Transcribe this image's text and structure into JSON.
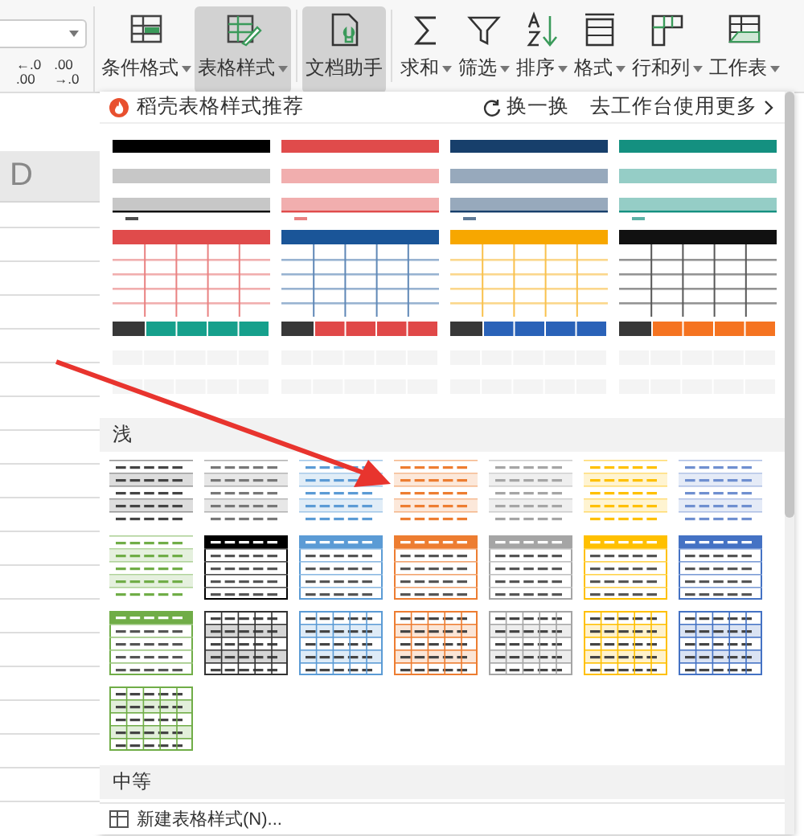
{
  "ribbon": {
    "decimal_buttons": [
      {
        "top": "←.0",
        "bottom": ".00"
      },
      {
        "top": ".00",
        "bottom": "→.0"
      }
    ],
    "tools": [
      {
        "label": "条件格式",
        "dropdown": true,
        "highlighted": false
      },
      {
        "label": "表格样式",
        "dropdown": true,
        "highlighted": true
      },
      {
        "label": "文档助手",
        "dropdown": false,
        "highlighted": true
      },
      {
        "label": "求和",
        "dropdown": true,
        "highlighted": false
      },
      {
        "label": "筛选",
        "dropdown": true,
        "highlighted": false
      },
      {
        "label": "排序",
        "dropdown": true,
        "highlighted": false
      },
      {
        "label": "格式",
        "dropdown": true,
        "highlighted": false
      },
      {
        "label": "行和列",
        "dropdown": true,
        "highlighted": false
      },
      {
        "label": "工作表",
        "dropdown": true,
        "highlighted": false
      }
    ]
  },
  "sheet": {
    "column_header": "D"
  },
  "style_panel": {
    "title": "稻壳表格样式推荐",
    "refresh": "换一换",
    "more": "去工作台使用更多",
    "recommended": [
      {
        "kind": "banded",
        "color": "#000000"
      },
      {
        "kind": "banded",
        "color": "#e04b4b"
      },
      {
        "kind": "banded",
        "color": "#173f6b"
      },
      {
        "kind": "banded",
        "color": "#149080"
      },
      {
        "kind": "grid",
        "color": "#e04b4b"
      },
      {
        "kind": "grid",
        "color": "#1a5598"
      },
      {
        "kind": "grid",
        "color": "#f7a700"
      },
      {
        "kind": "grid",
        "color": "#111111"
      },
      {
        "kind": "label",
        "color": "#16a08c"
      },
      {
        "kind": "label",
        "color": "#e04848"
      },
      {
        "kind": "label",
        "color": "#2a62b8"
      },
      {
        "kind": "label",
        "color": "#f57320"
      }
    ],
    "sections": [
      {
        "title": "浅",
        "styles": [
          {
            "kind": "banded",
            "color": "#444444"
          },
          {
            "kind": "banded",
            "color": "#777777"
          },
          {
            "kind": "banded",
            "color": "#5b9bd5"
          },
          {
            "kind": "banded",
            "color": "#ed7d31"
          },
          {
            "kind": "banded",
            "color": "#a5a5a5"
          },
          {
            "kind": "banded",
            "color": "#ffc000"
          },
          {
            "kind": "banded",
            "color": "#6f8fd0"
          },
          {
            "kind": "banded",
            "color": "#70ad47"
          },
          {
            "kind": "header",
            "color": "#000000"
          },
          {
            "kind": "header",
            "color": "#5b9bd5"
          },
          {
            "kind": "header",
            "color": "#ed7d31"
          },
          {
            "kind": "header",
            "color": "#a5a5a5"
          },
          {
            "kind": "header",
            "color": "#ffc000"
          },
          {
            "kind": "header",
            "color": "#4472c4"
          },
          {
            "kind": "header",
            "color": "#70ad47"
          },
          {
            "kind": "grid",
            "color": "#333333"
          },
          {
            "kind": "grid",
            "color": "#5b9bd5"
          },
          {
            "kind": "grid",
            "color": "#ed7d31"
          },
          {
            "kind": "grid",
            "color": "#a5a5a5"
          },
          {
            "kind": "grid",
            "color": "#ffc000"
          },
          {
            "kind": "grid",
            "color": "#4472c4"
          },
          {
            "kind": "grid",
            "color": "#70ad47"
          }
        ]
      },
      {
        "title": "中等"
      }
    ],
    "new_style": "新建表格样式(N)..."
  },
  "annotations": [
    {
      "kind": "arrow"
    }
  ]
}
